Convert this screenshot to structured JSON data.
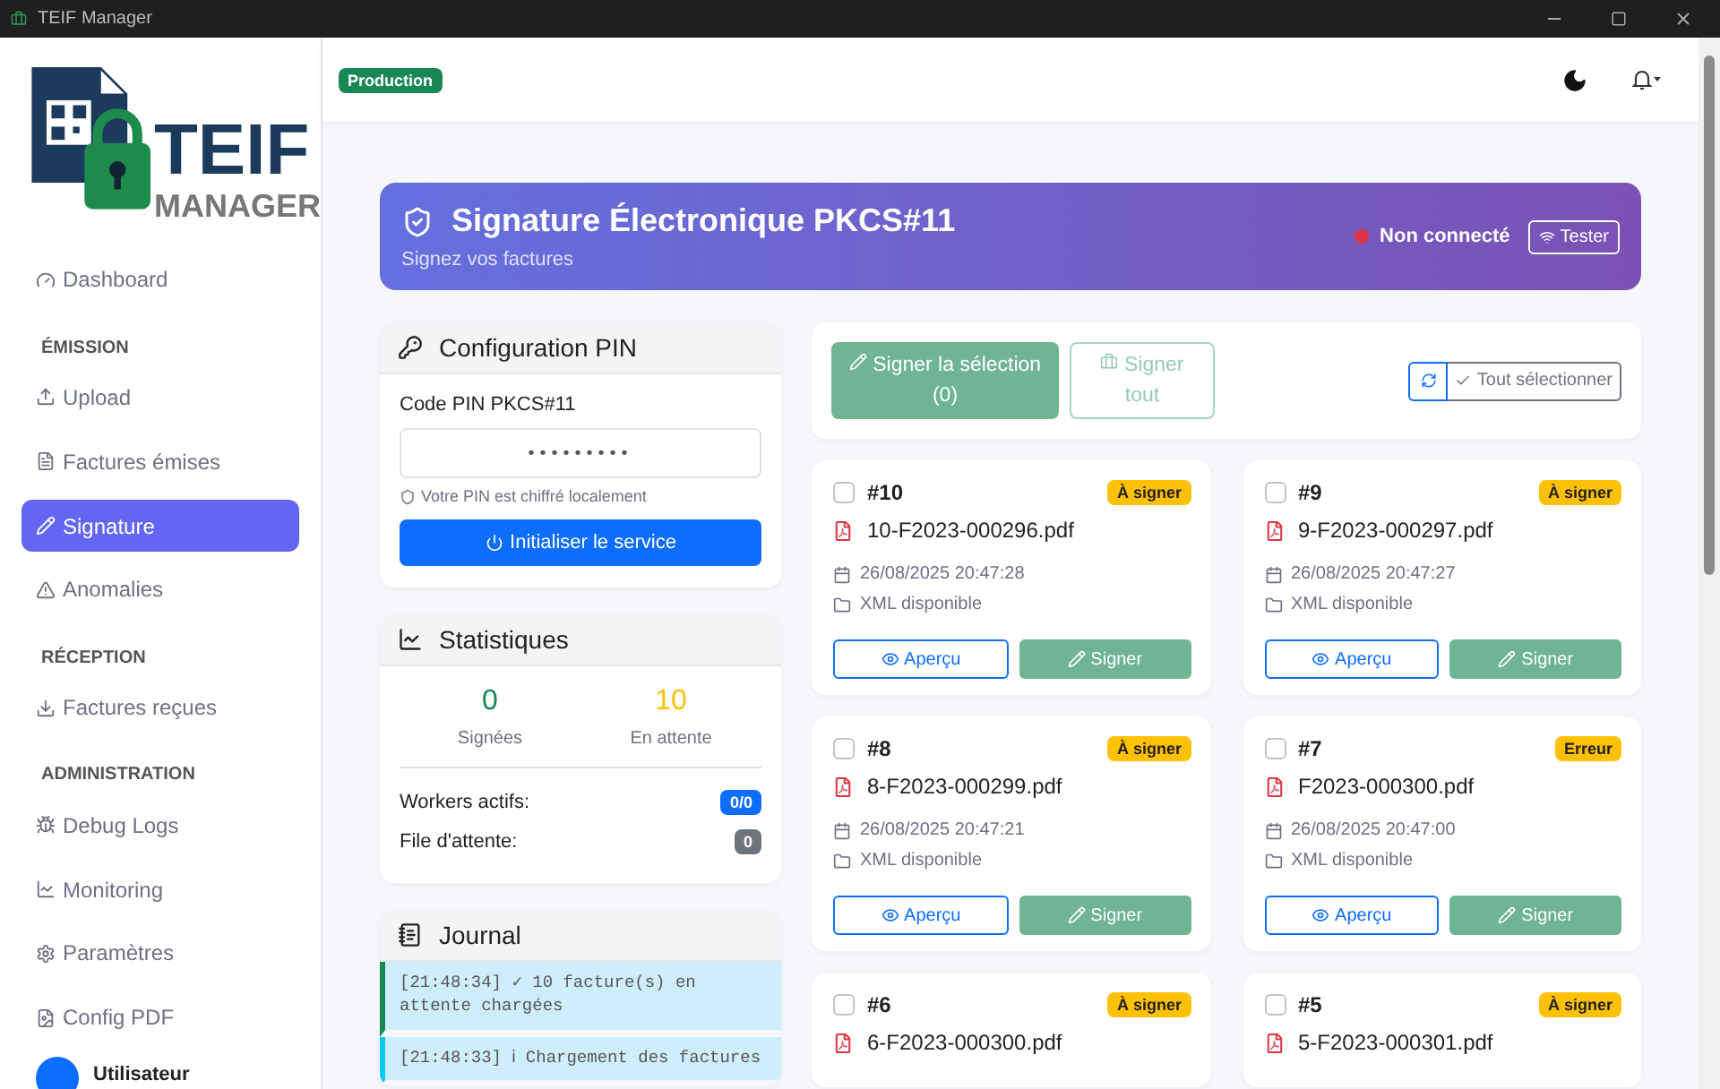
{
  "window": {
    "title": "TEIF Manager"
  },
  "sidebar": {
    "logo": {
      "title": "TEIF",
      "subtitle": "MANAGER"
    },
    "items": [
      {
        "kind": "link",
        "label": "Dashboard",
        "selected": false
      },
      {
        "kind": "section",
        "label": "ÉMISSION"
      },
      {
        "kind": "link",
        "label": "Upload",
        "selected": false
      },
      {
        "kind": "link",
        "label": "Factures émises",
        "selected": false
      },
      {
        "kind": "link",
        "label": "Signature",
        "selected": true
      },
      {
        "kind": "link",
        "label": "Anomalies",
        "selected": false
      },
      {
        "kind": "section",
        "label": "RÉCEPTION"
      },
      {
        "kind": "link",
        "label": "Factures reçues",
        "selected": false
      },
      {
        "kind": "section",
        "label": "ADMINISTRATION"
      },
      {
        "kind": "link",
        "label": "Debug Logs",
        "selected": false
      },
      {
        "kind": "link",
        "label": "Monitoring",
        "selected": false
      },
      {
        "kind": "link",
        "label": "Paramètres",
        "selected": false
      },
      {
        "kind": "link",
        "label": "Config PDF",
        "selected": false
      }
    ],
    "user": "Utilisateur"
  },
  "header": {
    "badge": "Production"
  },
  "banner": {
    "title": "Signature Électronique PKCS#11",
    "subtitle": "Signez vos factures",
    "status": "Non connecté",
    "connected": false,
    "button": "Tester"
  },
  "pin_panel": {
    "title": "Configuration PIN",
    "label": "Code PIN PKCS#11",
    "value": "•••••••••",
    "hint": "Votre PIN est chiffré localement",
    "button": "Initialiser le service"
  },
  "stats": {
    "title": "Statistiques",
    "figures": [
      {
        "value": "0",
        "label": "Signées",
        "color": "#198754"
      },
      {
        "value": "10",
        "label": "En attente",
        "color": "#ffc107"
      }
    ],
    "rows": [
      {
        "label": "Workers actifs:",
        "value": "0/0",
        "color": "#0d6efd"
      },
      {
        "label": "File d'attente:",
        "value": "0",
        "color": "#6c757d"
      }
    ]
  },
  "journal": {
    "title": "Journal",
    "entries": [
      {
        "kind": "success",
        "text": "[21:48:34] ✓ 10 facture(s) en attente chargées"
      },
      {
        "kind": "info",
        "text": "[21:48:33] ℹ Chargement des factures"
      }
    ]
  },
  "toolbar": {
    "sign_selection": "Signer la sélection (0)",
    "sign_all": "Signer tout",
    "select_all": "Tout sélectionner"
  },
  "invoices": [
    {
      "number": "#10",
      "status": "À signer",
      "file": "10-F2023-000296.pdf",
      "date": "26/08/2025 20:47:28",
      "xml": "XML disponible",
      "checked": false,
      "preview": "Aperçu",
      "sign": "Signer"
    },
    {
      "number": "#9",
      "status": "À signer",
      "file": "9-F2023-000297.pdf",
      "date": "26/08/2025 20:47:27",
      "xml": "XML disponible",
      "checked": false,
      "preview": "Aperçu",
      "sign": "Signer"
    },
    {
      "number": "#8",
      "status": "À signer",
      "file": "8-F2023-000299.pdf",
      "date": "26/08/2025 20:47:21",
      "xml": "XML disponible",
      "checked": false,
      "preview": "Aperçu",
      "sign": "Signer"
    },
    {
      "number": "#7",
      "status": "Erreur",
      "file": "F2023-000300.pdf",
      "date": "26/08/2025 20:47:00",
      "xml": "XML disponible",
      "checked": false,
      "preview": "Aperçu",
      "sign": "Signer"
    },
    {
      "number": "#6",
      "status": "À signer",
      "file": "6-F2023-000300.pdf",
      "checked": false
    },
    {
      "number": "#5",
      "status": "À signer",
      "file": "5-F2023-000301.pdf",
      "checked": false
    }
  ]
}
